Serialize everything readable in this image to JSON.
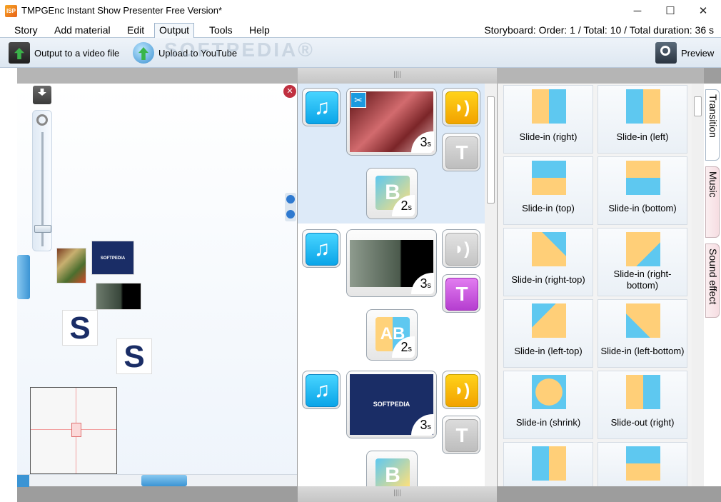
{
  "window": {
    "title": "TMPGEnc Instant Show Presenter Free Version*",
    "app_icon_text": "ISP",
    "minimize": "─",
    "maximize": "☐",
    "close": "✕"
  },
  "menu": {
    "items": [
      "Story",
      "Add material",
      "Edit",
      "Output",
      "Tools",
      "Help"
    ],
    "active": "Output"
  },
  "status": {
    "text": "Storyboard: Order: 1  / Total: 10  / Total duration: 36 s"
  },
  "toolbar": {
    "output_video": "Output to a video file",
    "upload_youtube": "Upload to YouTube",
    "preview": "Preview",
    "watermark": "SOFTPEDIA®"
  },
  "storyboard": {
    "rows": [
      {
        "duration": "3",
        "unit": "s",
        "transition_duration": "2",
        "transition_letter": "B",
        "sound_active": true,
        "text_active": false
      },
      {
        "duration": "3",
        "unit": "s",
        "transition_duration": "2",
        "transition_letter": "AB",
        "sound_active": false,
        "text_active": true
      },
      {
        "duration": "3",
        "unit": "s",
        "transition_duration": "",
        "transition_letter": "B",
        "sound_active": true,
        "text_active": false
      }
    ],
    "softpedia_logo": "SOFTPEDIA",
    "text_glyph": "T",
    "music_glyph": "♫",
    "sound_glyph": "◗)"
  },
  "transitions": {
    "items": [
      "Slide-in (right)",
      "Slide-in (left)",
      "Slide-in (top)",
      "Slide-in (bottom)",
      "Slide-in (right-top)",
      "Slide-in (right-bottom)",
      "Slide-in (left-top)",
      "Slide-in (left-bottom)",
      "Slide-in (shrink)",
      "Slide-out (right)"
    ]
  },
  "side_tabs": [
    "Transition",
    "Music",
    "Sound effect"
  ],
  "colors": {
    "music": "#13b3f0",
    "sound_active": "#f7b500",
    "text_active": "#c846d8",
    "inactive": "#c8c8c8",
    "highlight": "#ddeaf8"
  }
}
